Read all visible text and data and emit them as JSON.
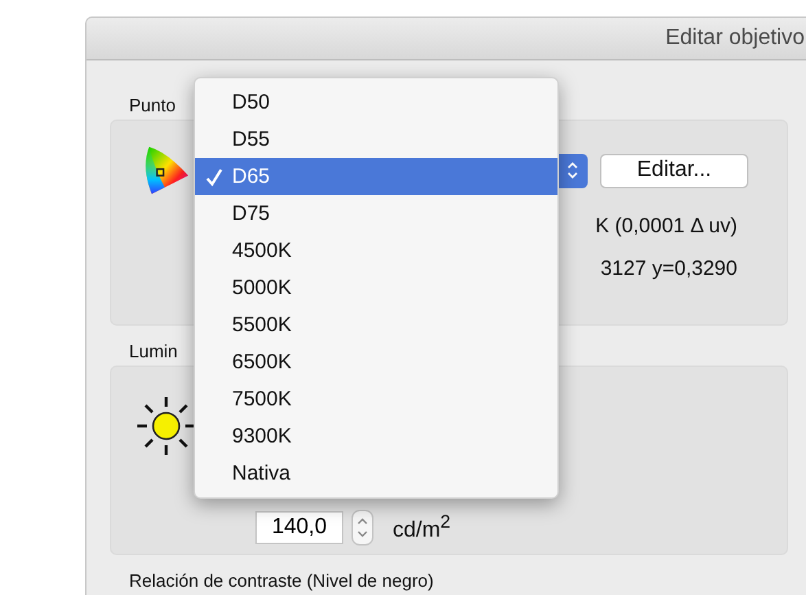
{
  "window": {
    "title": "Editar objetivo"
  },
  "white_point": {
    "label": "Punto",
    "edit_button": "Editar...",
    "color_temperature": "K (0,0001 Δ uv)",
    "cie_xy": "3127 y=0,3290"
  },
  "menu": {
    "items": [
      {
        "label": "D50",
        "selected": false
      },
      {
        "label": "D55",
        "selected": false
      },
      {
        "label": "D65",
        "selected": true
      },
      {
        "label": "D75",
        "selected": false
      },
      {
        "label": "4500K",
        "selected": false
      },
      {
        "label": "5000K",
        "selected": false
      },
      {
        "label": "5500K",
        "selected": false
      },
      {
        "label": "6500K",
        "selected": false
      },
      {
        "label": "7500K",
        "selected": false
      },
      {
        "label": "9300K",
        "selected": false
      },
      {
        "label": "Nativa",
        "selected": false
      }
    ]
  },
  "luminance": {
    "label": "Lumin",
    "value": "140,0",
    "unit": "cd/m$^{2}$"
  },
  "contrast": {
    "label": "Relación de contraste (Nivel de negro)"
  }
}
